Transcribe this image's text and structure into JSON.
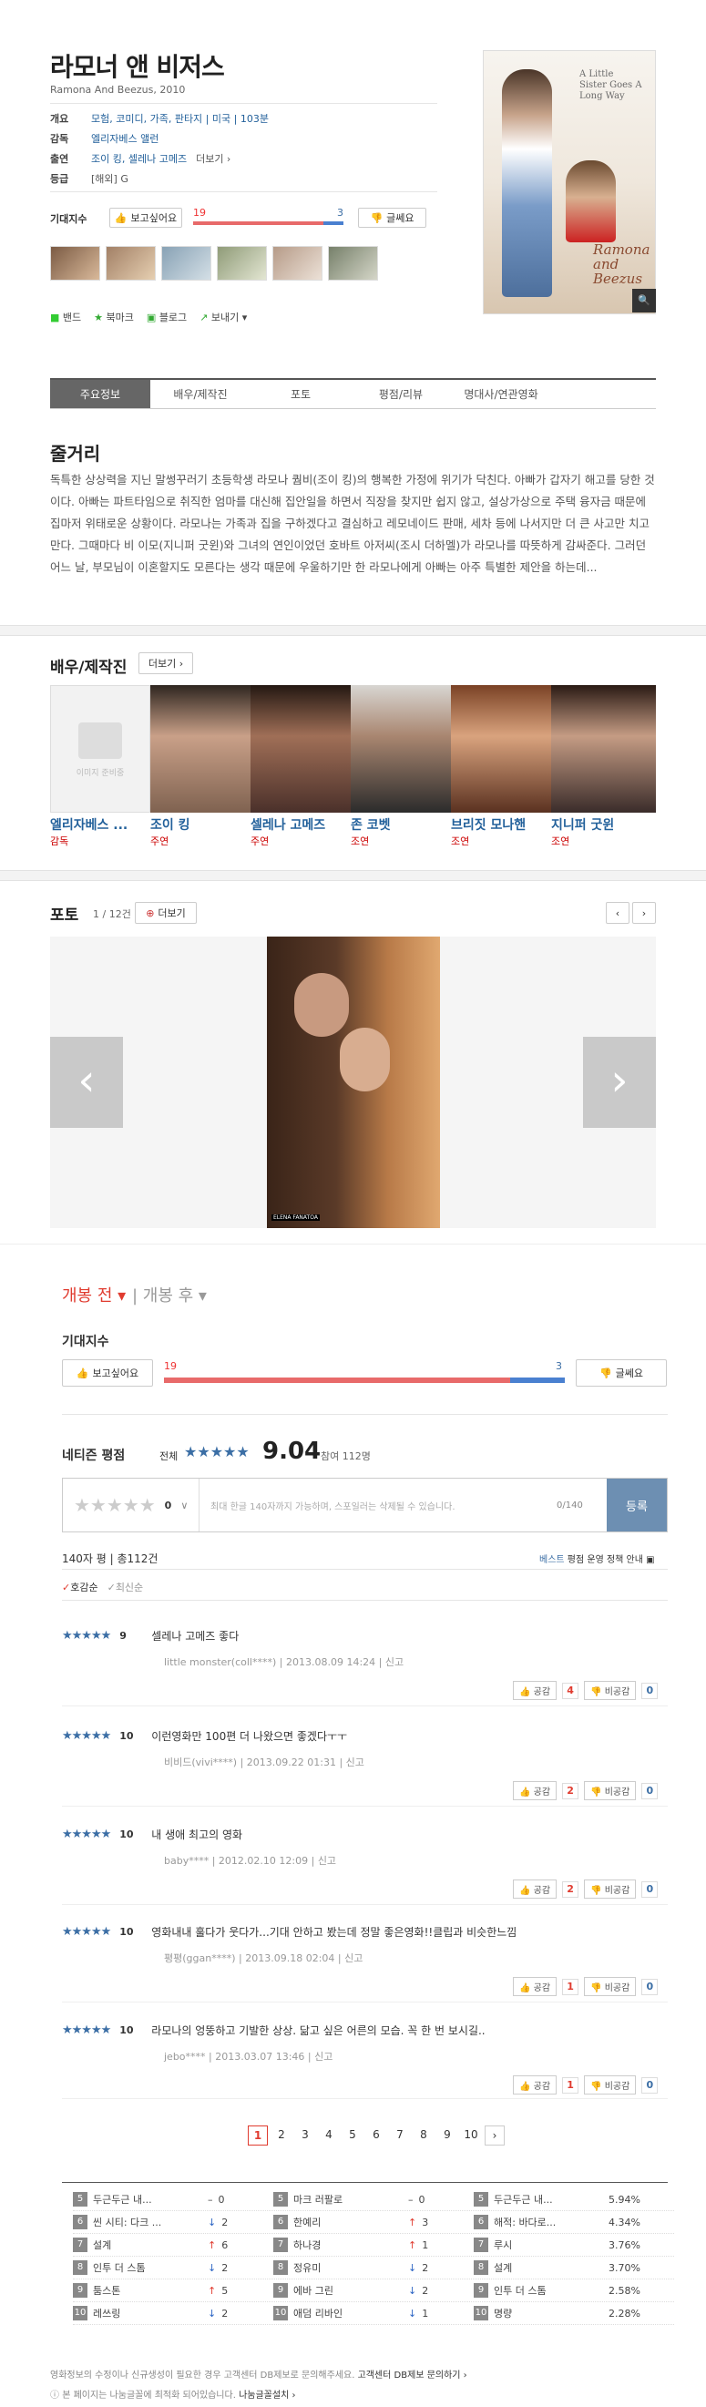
{
  "movie": {
    "title": "라모너 앤 비저스",
    "subtitle": "Ramona And Beezus, 2010",
    "genre_label": "개요",
    "genre": "모험, 코미디, 가족, 판타지 | 미국 | 103분",
    "director_label": "감독",
    "director": "엘리자베스 앨런",
    "cast_label": "출연",
    "cast": "조이 킹, 셀레나 고메즈",
    "cast_more": "더보기 ›",
    "grade_label": "등급",
    "grade": "[해외] G"
  },
  "expect": {
    "label": "기대지수",
    "want_label": "보고싶어요",
    "want_count": "19",
    "notwant_label": "글쎄요",
    "notwant_count": "3"
  },
  "share": {
    "band": "밴드",
    "bookmark": "북마크",
    "blog": "블로그",
    "send": "보내기"
  },
  "poster": {
    "tagline": "A Little Sister Goes A Long Way",
    "logo": "Ramona and Beezus"
  },
  "tabs": [
    "주요정보",
    "배우/제작진",
    "포토",
    "평점/리뷰",
    "명대사/연관영화"
  ],
  "synopsis": {
    "heading": "줄거리",
    "text": "독특한 상상력을 지닌 말썽꾸러기 초등학생 라모나 퀌비(조이 킹)의 행복한 가정에 위기가 닥친다. 아빠가 갑자기 해고를 당한 것이다. 아빠는 파트타임으로 취직한 엄마를 대신해 집안일을 하면서 직장을 찾지만 쉽지 않고, 설상가상으로 주택 융자금 때문에 집마저 위태로운 상황이다. 라모나는 가족과 집을 구하겠다고 결심하고 레모네이드 판매, 세차 등에 나서지만 더 큰 사고만 치고 만다. 그때마다 비 이모(지니퍼 굿윈)와 그녀의 연인이었던 호바트 아저씨(조시 더하멜)가 라모나를 따뜻하게 감싸준다. 그러던 어느 날, 부모님이 이혼할지도 모른다는 생각 때문에 우울하기만 한 라모나에게 아빠는 아주 특별한 제안을 하는데..."
  },
  "cast_section": {
    "heading": "배우/제작진",
    "more": "더보기 ›",
    "no_image": "이미지 준비중",
    "people": [
      {
        "name": "엘리자베스 ...",
        "role": "감독"
      },
      {
        "name": "조이 킹",
        "role": "주연"
      },
      {
        "name": "셀레나 고메즈",
        "role": "주연"
      },
      {
        "name": "존 코벳",
        "role": "조연"
      },
      {
        "name": "브리짓 모나핸",
        "role": "조연"
      },
      {
        "name": "지니퍼 굿윈",
        "role": "조연"
      }
    ]
  },
  "photo_section": {
    "heading": "포토",
    "counter": "1 / 12건",
    "more": "더보기",
    "credit": "ELENA  FANATOA"
  },
  "release_tabs": {
    "before": "개봉 전",
    "after": "개봉 후"
  },
  "expect2": {
    "label": "기대지수",
    "want_label": "보고싶어요",
    "want_count": "19",
    "notwant_label": "글쎄요",
    "notwant_count": "3"
  },
  "netizen": {
    "heading": "네티즌 평점",
    "all": "전체",
    "score": "9.04",
    "participants": "참여 112명",
    "input_score": "0",
    "placeholder": "최대 한글 140자까지 가능하며, 스포일러는 삭제될 수 있습니다.",
    "char_count": "0/140",
    "submit": "등록",
    "count_label": "140자 평",
    "total": "총112건",
    "policy_best": "베스트",
    "policy_text": "평점 운영 정책 안내",
    "sort_good": "호감순",
    "sort_new": "최신순",
    "report": "신고"
  },
  "reviews": [
    {
      "score": "9",
      "text": "셀레나 고메즈 좋다",
      "author": "little monster(coll****)",
      "date": "2013.08.09 14:24",
      "like": "공감",
      "like_n": "4",
      "dislike": "비공감",
      "dislike_n": "0"
    },
    {
      "score": "10",
      "text": "이런영화만 100편 더 나왔으면 좋겠다ㅜㅜ",
      "author": "비비드(vivi****)",
      "date": "2013.09.22 01:31",
      "like": "공감",
      "like_n": "2",
      "dislike": "비공감",
      "dislike_n": "0"
    },
    {
      "score": "10",
      "text": "내 생애 최고의 영화",
      "author": "baby****",
      "date": "2012.02.10 12:09",
      "like": "공감",
      "like_n": "2",
      "dislike": "비공감",
      "dislike_n": "0"
    },
    {
      "score": "10",
      "text": "영화내내 훌다가 웃다가...기대 안하고 봤는데 정말 좋은영화!!클립과 비슷한느낌",
      "author": "평평(ggan****)",
      "date": "2013.09.18 02:04",
      "like": "공감",
      "like_n": "1",
      "dislike": "비공감",
      "dislike_n": "0"
    },
    {
      "score": "10",
      "text": "라모나의 엉뚱하고 기발한 상상. 닮고 싶은 어른의 모습. 꼭 한 번 보시길..",
      "author": "jebo****",
      "date": "2013.03.07 13:46",
      "like": "공감",
      "like_n": "1",
      "dislike": "비공감",
      "dislike_n": "0"
    }
  ],
  "pages": [
    "1",
    "2",
    "3",
    "4",
    "5",
    "6",
    "7",
    "8",
    "9",
    "10"
  ],
  "ranking": [
    [
      {
        "n": "5",
        "name": "두근두근 내...",
        "ch": "–",
        "v": "0"
      },
      {
        "n": "5",
        "name": "마크 러팔로",
        "ch": "–",
        "v": "0"
      },
      {
        "n": "5",
        "name": "두근두근 내...",
        "ch": "",
        "v": "5.94%"
      }
    ],
    [
      {
        "n": "6",
        "name": "씬 시티: 다크 ...",
        "ch": "↓",
        "v": "2"
      },
      {
        "n": "6",
        "name": "한예리",
        "ch": "↑",
        "v": "3"
      },
      {
        "n": "6",
        "name": "해적: 바다로...",
        "ch": "",
        "v": "4.34%"
      }
    ],
    [
      {
        "n": "7",
        "name": "설계",
        "ch": "↑",
        "v": "6"
      },
      {
        "n": "7",
        "name": "하나경",
        "ch": "↑",
        "v": "1"
      },
      {
        "n": "7",
        "name": "루시",
        "ch": "",
        "v": "3.76%"
      }
    ],
    [
      {
        "n": "8",
        "name": "인투 더 스톰",
        "ch": "↓",
        "v": "2"
      },
      {
        "n": "8",
        "name": "정유미",
        "ch": "↓",
        "v": "2"
      },
      {
        "n": "8",
        "name": "설계",
        "ch": "",
        "v": "3.70%"
      }
    ],
    [
      {
        "n": "9",
        "name": "툼스톤",
        "ch": "↑",
        "v": "5"
      },
      {
        "n": "9",
        "name": "에바 그린",
        "ch": "↓",
        "v": "2"
      },
      {
        "n": "9",
        "name": "인투 더 스톰",
        "ch": "",
        "v": "2.58%"
      }
    ],
    [
      {
        "n": "10",
        "name": "레쓰링",
        "ch": "↓",
        "v": "2"
      },
      {
        "n": "10",
        "name": "애덤 리바인",
        "ch": "↓",
        "v": "1"
      },
      {
        "n": "10",
        "name": "명량",
        "ch": "",
        "v": "2.28%"
      }
    ]
  ],
  "footer": {
    "line1": "영화정보의 수정이나 신규생성이 필요한 경우 고객센터 DB제보로 문의해주세요.",
    "link1": "고객센터 DB제보 문의하기 ›",
    "line2": "본 페이지는 나눔글꼴에 최적화 되어있습니다.",
    "link2": "나눔글꼴설치 ›"
  }
}
